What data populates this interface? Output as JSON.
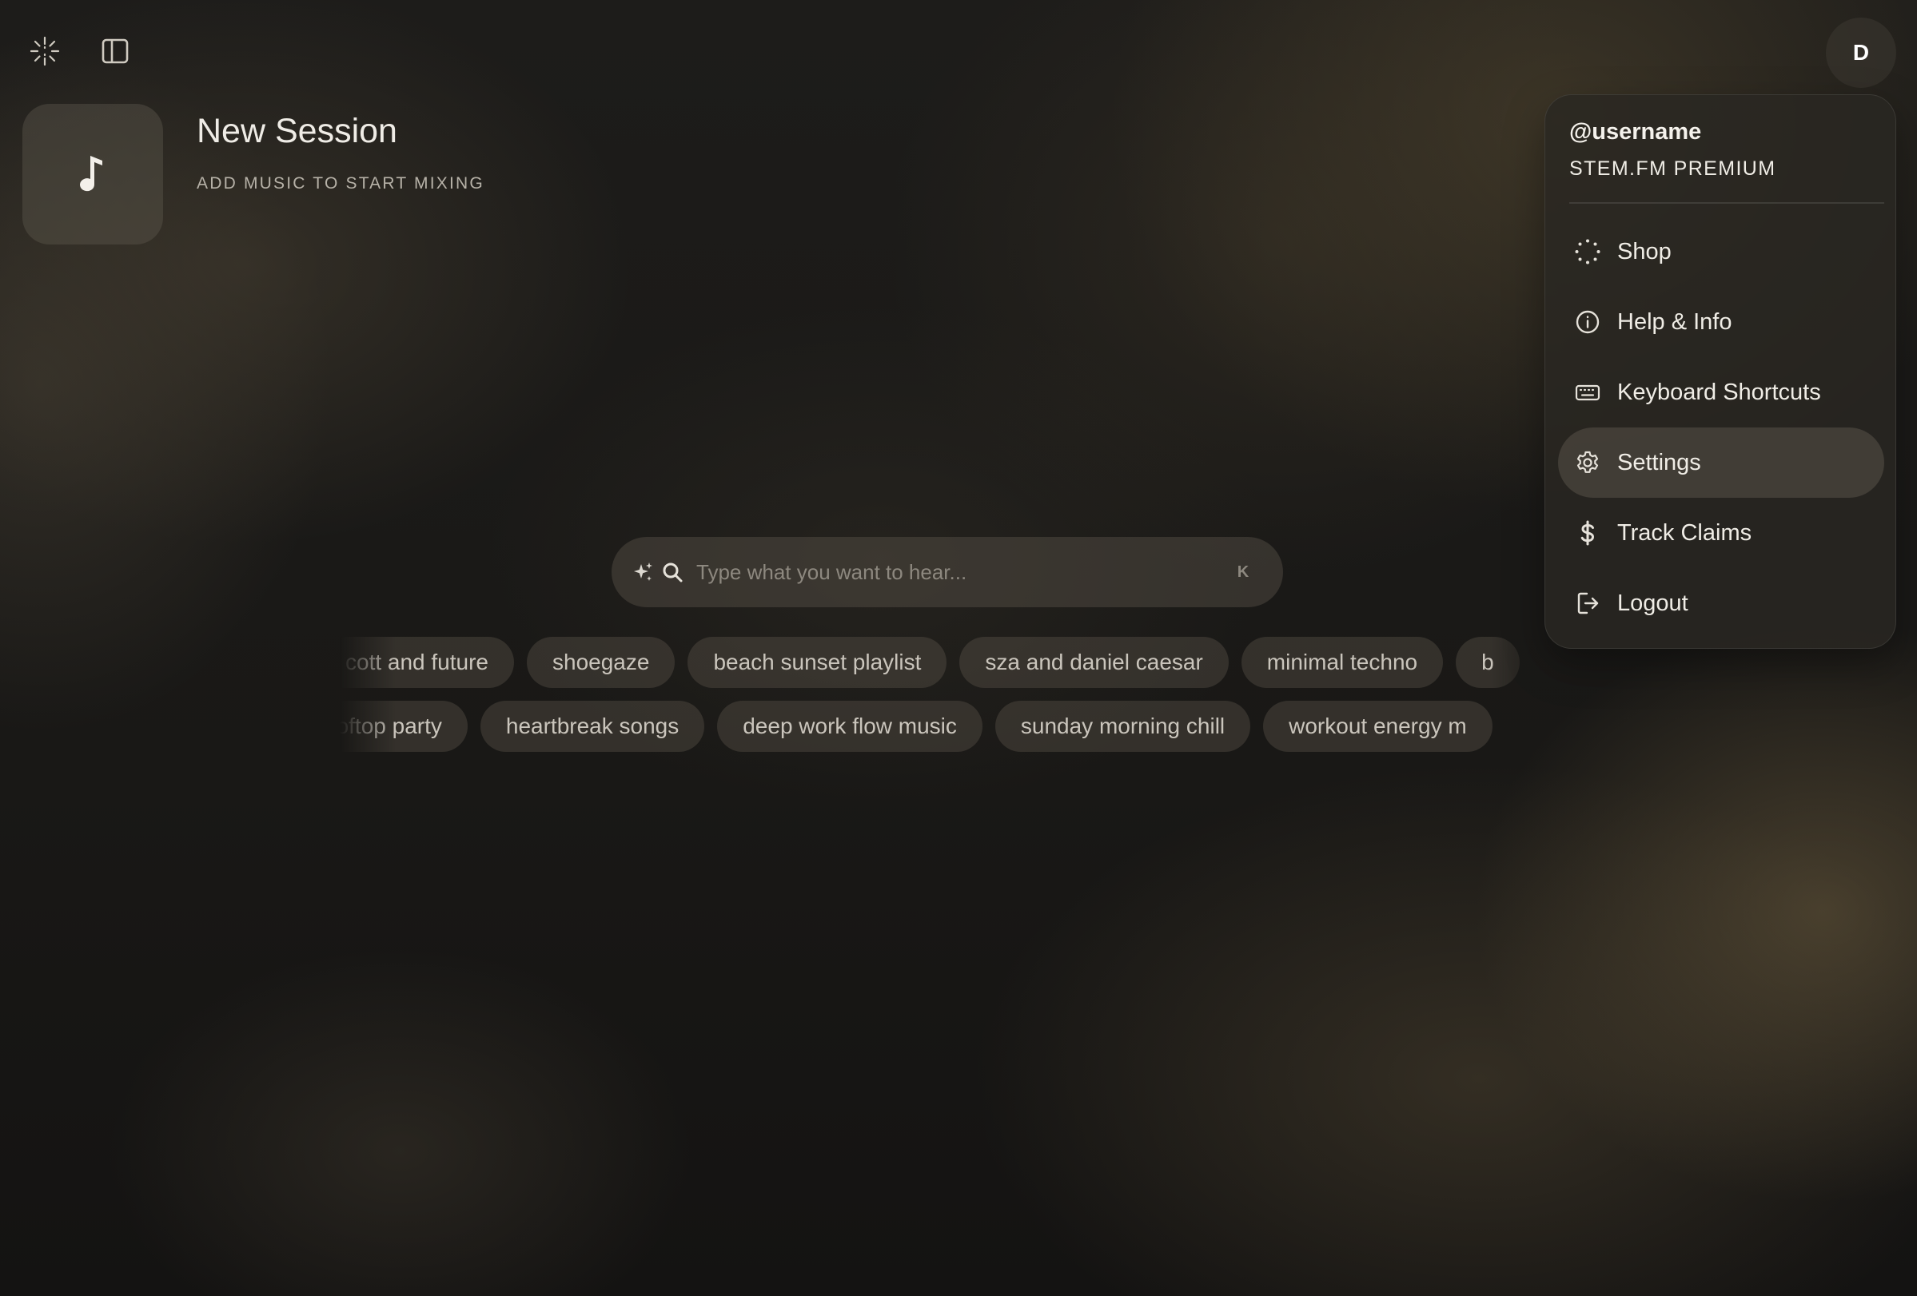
{
  "session": {
    "title": "New Session",
    "subtitle": "ADD MUSIC TO START MIXING"
  },
  "avatar": {
    "initial": "D"
  },
  "search": {
    "placeholder": "Type what you want to hear...",
    "shortcut": "K"
  },
  "suggestions": {
    "row1": [
      "cott and future",
      "shoegaze",
      "beach sunset playlist",
      "sza and daniel caesar",
      "minimal techno",
      "b"
    ],
    "row2": [
      "ooftop party",
      "heartbreak songs",
      "deep work flow music",
      "sunday morning chill",
      "workout energy m"
    ]
  },
  "menu": {
    "username": "@username",
    "plan": "STEM.FM PREMIUM",
    "items": [
      {
        "label": "Shop",
        "icon": "loader-dots-icon"
      },
      {
        "label": "Help & Info",
        "icon": "info-icon"
      },
      {
        "label": "Keyboard Shortcuts",
        "icon": "keyboard-icon"
      },
      {
        "label": "Settings",
        "icon": "gear-icon",
        "active": true
      },
      {
        "label": "Track Claims",
        "icon": "dollar-icon"
      },
      {
        "label": "Logout",
        "icon": "logout-icon"
      }
    ]
  }
}
